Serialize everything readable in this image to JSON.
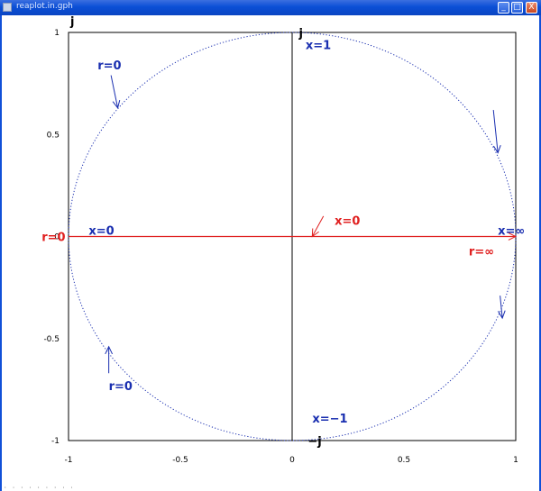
{
  "window": {
    "title": "reaplot.in.gph",
    "buttons": {
      "minimize": "_",
      "maximize": "□",
      "close": "X"
    }
  },
  "footer": {
    "status": "· · · · · · · · ·"
  },
  "colors": {
    "circle": "#1a2fb0",
    "real_axis": "#e02020",
    "annotation_blue": "#1a2fb0",
    "annotation_red": "#e02020"
  },
  "chart_data": {
    "type": "line",
    "title": "",
    "xlabel": "",
    "ylabel": "j",
    "xlim": [
      -1,
      1
    ],
    "ylim": [
      -1,
      1
    ],
    "x_ticks": [
      "-1",
      "-0.5",
      "0",
      "0.5",
      "1"
    ],
    "y_ticks": [
      "1",
      "0.5",
      "0",
      "-0.5",
      "-1"
    ],
    "grid": false,
    "series": [
      {
        "kind": "unit-circle",
        "style": "dotted",
        "color": "#1a2fb0",
        "center": [
          0,
          0
        ],
        "radius": 1
      },
      {
        "kind": "real-axis-segment",
        "style": "solid",
        "color": "#e02020",
        "x": [
          -1,
          1
        ],
        "y": [
          0,
          0
        ]
      }
    ],
    "annotations": [
      {
        "text": "j",
        "at": [
          0.03,
          1.0
        ],
        "color": "black"
      },
      {
        "text": "x=1",
        "at": [
          0.06,
          0.94
        ],
        "color": "blue"
      },
      {
        "text": "−j",
        "at": [
          0.07,
          -1.0
        ],
        "color": "black"
      },
      {
        "text": "x=−1",
        "at": [
          0.09,
          -0.89
        ],
        "color": "blue"
      },
      {
        "text": "x=0",
        "at": [
          -0.91,
          0.03
        ],
        "color": "blue"
      },
      {
        "text": "x=∞",
        "at": [
          0.92,
          0.03
        ],
        "color": "blue"
      },
      {
        "text": "r=0",
        "at": [
          -1.12,
          0.0
        ],
        "color": "red"
      },
      {
        "text": "r=∞",
        "at": [
          0.79,
          -0.07
        ],
        "color": "red"
      },
      {
        "text": "x=0",
        "at": [
          0.19,
          0.08
        ],
        "color": "red"
      },
      {
        "text": "r=0",
        "at": [
          -0.87,
          0.84
        ],
        "color": "blue"
      },
      {
        "text": "r=0",
        "at": [
          -0.82,
          -0.73
        ],
        "color": "blue"
      }
    ],
    "arrows": [
      {
        "from": [
          -0.81,
          0.79
        ],
        "to": [
          -0.78,
          0.63
        ],
        "color": "blue"
      },
      {
        "from": [
          -0.82,
          -0.67
        ],
        "to": [
          -0.82,
          -0.54
        ],
        "color": "blue"
      },
      {
        "from": [
          0.9,
          0.62
        ],
        "to": [
          0.92,
          0.41
        ],
        "color": "blue"
      },
      {
        "from": [
          0.93,
          -0.29
        ],
        "to": [
          0.94,
          -0.4
        ],
        "color": "blue"
      },
      {
        "from": [
          0.14,
          0.1
        ],
        "to": [
          0.09,
          0.0
        ],
        "color": "red"
      },
      {
        "from": [
          0.95,
          0.0
        ],
        "to": [
          1.0,
          0.0
        ],
        "color": "red"
      }
    ]
  }
}
